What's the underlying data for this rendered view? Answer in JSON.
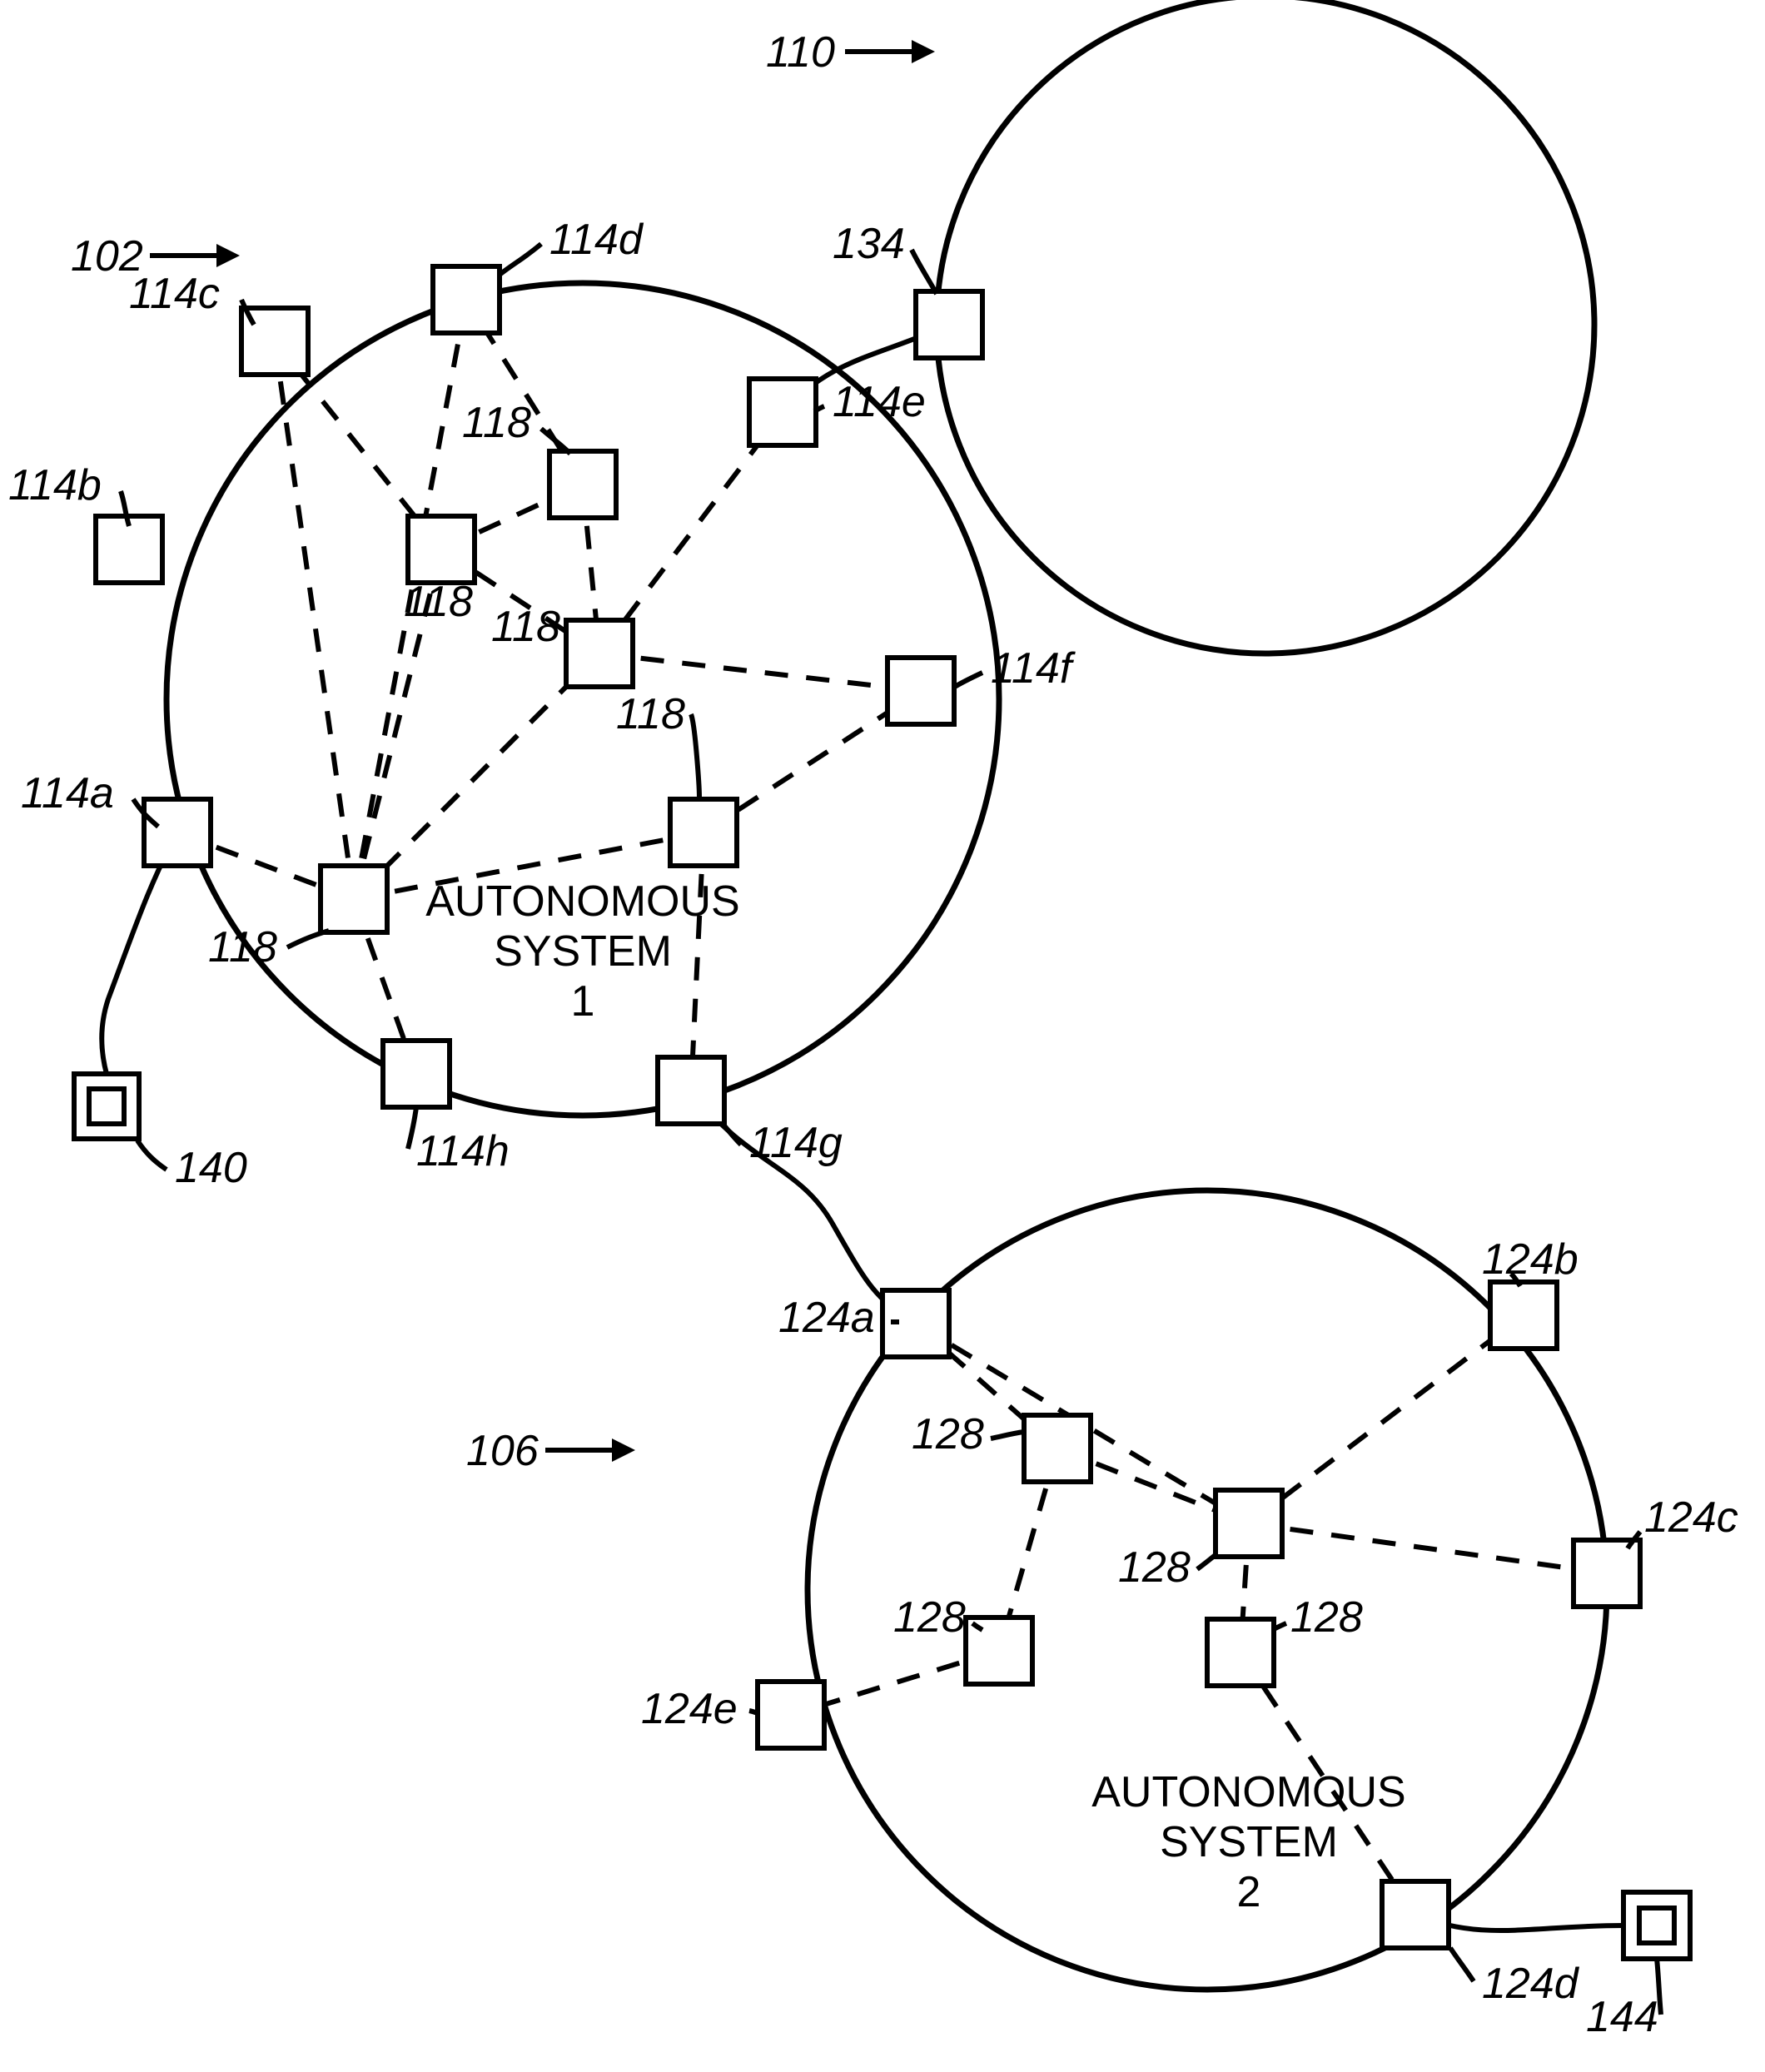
{
  "figureRefs": {
    "upperRight": "110",
    "upperLeft": "102",
    "midLeft": "106"
  },
  "labels": {
    "l114a": "114a",
    "l114b": "114b",
    "l114c": "114c",
    "l114d": "114d",
    "l114e": "114e",
    "l114f": "114f",
    "l114g": "114g",
    "l114h": "114h",
    "l118_1": "118",
    "l118_2": "118",
    "l118_3": "118",
    "l118_4": "118",
    "l118_5": "118",
    "l124a": "124a",
    "l124b": "124b",
    "l124c": "124c",
    "l124d": "124d",
    "l124e": "124e",
    "l128_1": "128",
    "l128_2": "128",
    "l128_3": "128",
    "l128_4": "128",
    "l134": "134",
    "l140": "140",
    "l144": "144"
  },
  "systems": {
    "as1_line1": "AUTONOMOUS",
    "as1_line2": "SYSTEM",
    "as1_line3": "1",
    "as2_line1": "AUTONOMOUS",
    "as2_line2": "SYSTEM",
    "as2_line3": "2"
  }
}
